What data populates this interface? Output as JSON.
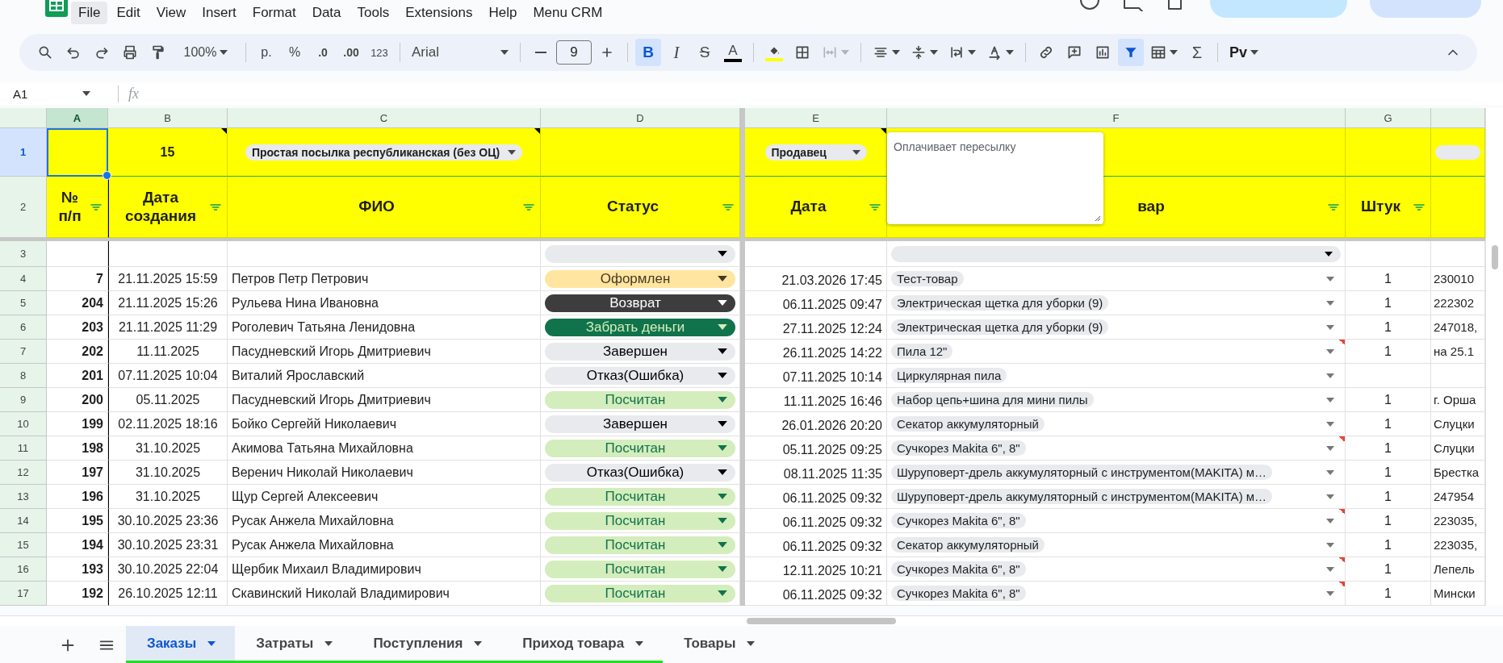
{
  "menu": [
    {
      "label": "File",
      "selected": true
    },
    {
      "label": "Edit",
      "selected": false
    },
    {
      "label": "View",
      "selected": false
    },
    {
      "label": "Insert",
      "selected": false
    },
    {
      "label": "Format",
      "selected": false
    },
    {
      "label": "Data",
      "selected": false
    },
    {
      "label": "Tools",
      "selected": false
    },
    {
      "label": "Extensions",
      "selected": false
    },
    {
      "label": "Help",
      "selected": false
    },
    {
      "label": "Menu CRM",
      "selected": false
    }
  ],
  "toolbar": {
    "zoom": "100%",
    "currency": "р.",
    "percent": "%",
    "decrease_decimals": ".0",
    "increase_decimals": ".00",
    "number_format": "123",
    "font": "Arial",
    "font_size": "9",
    "bold": {
      "label": "B",
      "selected": true
    },
    "italic": "I",
    "strikethrough": "S",
    "text_color": "A",
    "merge": {
      "disabled": true
    },
    "filter": {
      "selected": true
    },
    "sum": "Σ",
    "addon": "Pv"
  },
  "formula_bar": {
    "cell_ref": "A1",
    "fx": "fx"
  },
  "columns": [
    {
      "letter": "A",
      "selected": true
    },
    {
      "letter": "B",
      "selected": false
    },
    {
      "letter": "C",
      "selected": false
    },
    {
      "letter": "D",
      "selected": false
    },
    {
      "letter": "E",
      "selected": false
    },
    {
      "letter": "F",
      "selected": false
    },
    {
      "letter": "G",
      "selected": false
    }
  ],
  "row_1": {
    "number": "1",
    "selected": true,
    "b": {
      "text": "15",
      "note": true
    },
    "c": {
      "chip": "Простая посылка республиканская (без ОЦ)",
      "note": true
    },
    "e": {
      "chip": "Продавец",
      "note": true
    }
  },
  "row_2": {
    "number": "2",
    "selected": false,
    "headers": [
      "№ п/п",
      "Дата создания",
      "ФИО",
      "Статус",
      "Дата",
      "вар",
      "Штук"
    ]
  },
  "note_popup": {
    "text": "Оплачивает пересылку"
  },
  "rows": [
    {
      "number": "3",
      "status": {
        "kind": "empty"
      },
      "product": {
        "kind": "empty",
        "note": false
      }
    },
    {
      "number": "4",
      "id": "7",
      "created": "21.11.2025 15:59",
      "name": "Петров Петр Петрович",
      "status": {
        "kind": "formed",
        "label": "Оформлен"
      },
      "date": "21.03.2026 17:45",
      "product": {
        "kind": "item",
        "label": "Тест-товар",
        "note": false
      },
      "qty": "1",
      "address": "230010"
    },
    {
      "number": "5",
      "id": "204",
      "created": "21.11.2025 15:26",
      "name": "Рульева Нина Ивановна",
      "status": {
        "kind": "returned",
        "label": "Возврат"
      },
      "date": "06.11.2025 09:47",
      "product": {
        "kind": "item",
        "label": "Электрическая щетка для уборки (9)",
        "note": false
      },
      "qty": "1",
      "address": "222302"
    },
    {
      "number": "6",
      "id": "203",
      "created": "21.11.2025 11:29",
      "name": "Роголевич Татьяна Ленидовна",
      "status": {
        "kind": "collect",
        "label": "Забрать деньги"
      },
      "date": "27.11.2025 12:24",
      "product": {
        "kind": "item",
        "label": "Электрическая щетка для уборки (9)",
        "note": false
      },
      "qty": "1",
      "address": "247018,"
    },
    {
      "number": "7",
      "id": "202",
      "created": "11.11.2025",
      "name": "Пасудневский Игорь Дмитриевич",
      "status": {
        "kind": "completed",
        "label": "Завершен"
      },
      "date": "26.11.2025 14:22",
      "product": {
        "kind": "item",
        "label": "Пила 12\"",
        "note": true
      },
      "qty": "1",
      "address": "на 25.1"
    },
    {
      "number": "8",
      "id": "201",
      "created": "07.11.2025 10:04",
      "name": "Виталий Ярославский",
      "status": {
        "kind": "failed",
        "label": "Отказ(Ошибка)"
      },
      "date": "07.11.2025 10:14",
      "product": {
        "kind": "item",
        "label": "Циркулярная пила",
        "note": false
      }
    },
    {
      "number": "9",
      "id": "200",
      "created": "05.11.2025",
      "name": "Пасудневский Игорь Дмитриевич",
      "status": {
        "kind": "counted",
        "label": "Посчитан"
      },
      "date": "11.11.2025 16:46",
      "product": {
        "kind": "item",
        "label": "Набор цепь+шина для мини пилы",
        "note": false
      },
      "qty": "1",
      "address": "г. Орша"
    },
    {
      "number": "10",
      "id": "199",
      "created": "02.11.2025 18:16",
      "name": "Бойко Сергейй Николаевич",
      "status": {
        "kind": "completed",
        "label": "Завершен"
      },
      "date": "26.01.2026 20:20",
      "product": {
        "kind": "item",
        "label": "Секатор аккумуляторный",
        "note": false
      },
      "qty": "1",
      "address": "Слуцки"
    },
    {
      "number": "11",
      "id": "198",
      "created": "31.10.2025",
      "name": "Акимова Татьяна Михайловна",
      "status": {
        "kind": "counted",
        "label": "Посчитан"
      },
      "date": "05.11.2025 09:25",
      "product": {
        "kind": "item",
        "label": "Сучкорез Makita  6\", 8\"",
        "note": true
      },
      "qty": "1",
      "address": "Слуцки"
    },
    {
      "number": "12",
      "id": "197",
      "created": "31.10.2025",
      "name": "Веренич Николай Николаевич",
      "status": {
        "kind": "failed",
        "label": "Отказ(Ошибка)"
      },
      "date": "08.11.2025 11:35",
      "product": {
        "kind": "item",
        "label": "Шуруповерт-дрель аккумуляторный с инструментом(MAKITA) м…",
        "note": false
      },
      "qty": "1",
      "address": "Брестка"
    },
    {
      "number": "13",
      "id": "196",
      "created": "31.10.2025",
      "name": "Щур Сергей Алексеевич",
      "status": {
        "kind": "counted",
        "label": "Посчитан"
      },
      "date": "06.11.2025 09:32",
      "product": {
        "kind": "item",
        "label": "Шуруповерт-дрель аккумуляторный с инструментом(MAKITA) м…",
        "note": false
      },
      "qty": "1",
      "address": "247954"
    },
    {
      "number": "14",
      "id": "195",
      "created": "30.10.2025 23:36",
      "name": "Русак Анжела Михайловна",
      "status": {
        "kind": "counted",
        "label": "Посчитан"
      },
      "date": "06.11.2025 09:32",
      "product": {
        "kind": "item",
        "label": "Сучкорез Makita  6\", 8\"",
        "note": true
      },
      "qty": "1",
      "address": "223035,"
    },
    {
      "number": "15",
      "id": "194",
      "created": "30.10.2025 23:31",
      "name": "Русак Анжела Михайловна",
      "status": {
        "kind": "counted",
        "label": "Посчитан"
      },
      "date": "06.11.2025 09:32",
      "product": {
        "kind": "item",
        "label": "Секатор аккумуляторный",
        "note": false
      },
      "qty": "1",
      "address": "223035,"
    },
    {
      "number": "16",
      "id": "193",
      "created": "30.10.2025 22:04",
      "name": "Щербик Михаил Владимирович",
      "status": {
        "kind": "counted",
        "label": "Посчитан"
      },
      "date": "12.11.2025 10:21",
      "product": {
        "kind": "item",
        "label": "Сучкорез Makita  6\", 8\"",
        "note": true
      },
      "qty": "1",
      "address": "Лепель"
    },
    {
      "number": "17",
      "id": "192",
      "created": "26.10.2025 12:11",
      "name": "Скавинский Николай Владимирович",
      "status": {
        "kind": "counted",
        "label": "Посчитан"
      },
      "date": "06.11.2025 09:32",
      "product": {
        "kind": "item",
        "label": "Сучкорез Makita  6\", 8\"",
        "note": true
      },
      "qty": "1",
      "address": "Мински"
    }
  ],
  "sheet_tabs": [
    {
      "label": "Заказы",
      "selected": true,
      "color": "#1ee01e"
    },
    {
      "label": "Затраты",
      "selected": false,
      "color": "#1ee01e"
    },
    {
      "label": "Поступления",
      "selected": false,
      "color": "#1ee01e"
    },
    {
      "label": "Приход товара",
      "selected": false,
      "color": "#1ee01e"
    },
    {
      "label": "Товары",
      "selected": false
    }
  ]
}
